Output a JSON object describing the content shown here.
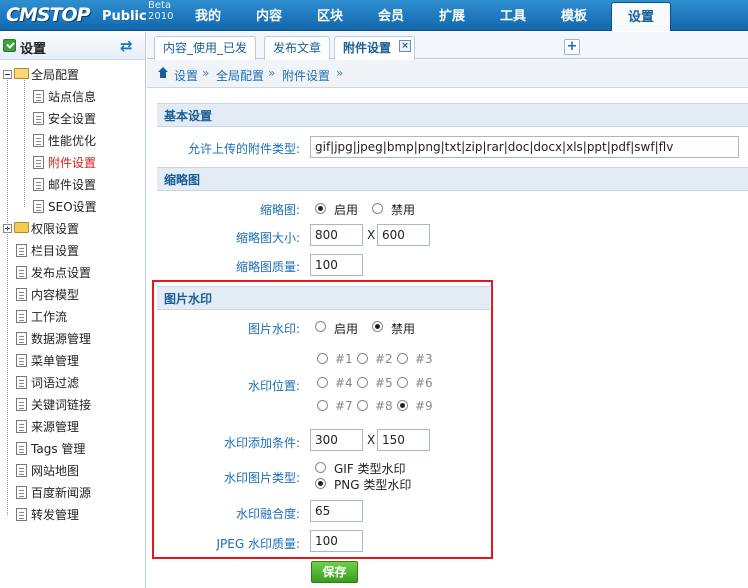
{
  "logo": {
    "brand": "CMSTOP",
    "edition": "Public",
    "beta": "Beta",
    "year": "2010"
  },
  "main_nav": [
    "我的",
    "内容",
    "区块",
    "会员",
    "扩展",
    "工具",
    "模板",
    "设置"
  ],
  "main_nav_active": "设置",
  "sidebar": {
    "title": "设置",
    "items": [
      {
        "label": "全局配置",
        "type": "folder-open"
      },
      {
        "label": "站点信息",
        "type": "child"
      },
      {
        "label": "安全设置",
        "type": "child"
      },
      {
        "label": "性能优化",
        "type": "child"
      },
      {
        "label": "附件设置",
        "type": "child",
        "selected": true
      },
      {
        "label": "邮件设置",
        "type": "child"
      },
      {
        "label": "SEO设置",
        "type": "child"
      },
      {
        "label": "权限设置",
        "type": "folder"
      },
      {
        "label": "栏目设置",
        "type": "doc"
      },
      {
        "label": "发布点设置",
        "type": "doc"
      },
      {
        "label": "内容模型",
        "type": "doc"
      },
      {
        "label": "工作流",
        "type": "doc"
      },
      {
        "label": "数据源管理",
        "type": "doc"
      },
      {
        "label": "菜单管理",
        "type": "doc"
      },
      {
        "label": "词语过滤",
        "type": "doc"
      },
      {
        "label": "关键词链接",
        "type": "doc"
      },
      {
        "label": "来源管理",
        "type": "doc"
      },
      {
        "label": "Tags 管理",
        "type": "doc"
      },
      {
        "label": "网站地图",
        "type": "doc"
      },
      {
        "label": "百度新闻源",
        "type": "doc"
      },
      {
        "label": "转发管理",
        "type": "doc"
      }
    ]
  },
  "tabs": [
    "内容_使用_已发",
    "发布文章",
    "附件设置"
  ],
  "active_tab": "附件设置",
  "tab_close": "×",
  "tab_add": "+",
  "breadcrumb": [
    "设置",
    "全局配置",
    "附件设置"
  ],
  "breadcrumb_sep": "»",
  "basic": {
    "section_title": "基本设置",
    "allowed_types_label": "允许上传的附件类型:",
    "allowed_types_value": "gif|jpg|jpeg|bmp|png|txt|zip|rar|doc|docx|xls|ppt|pdf|swf|flv"
  },
  "thumb": {
    "section_title": "缩略图",
    "thumb_label": "缩略图:",
    "enable": "启用",
    "disable": "禁用",
    "thumb_enabled": true,
    "size_label": "缩略图大小:",
    "width": "800",
    "height": "600",
    "x": "X",
    "quality_label": "缩略图质量:",
    "quality": "100"
  },
  "watermark": {
    "section_title": "图片水印",
    "wm_label": "图片水印:",
    "enable": "启用",
    "disable": "禁用",
    "wm_enabled": false,
    "position_label": "水印位置:",
    "positions": [
      "#1",
      "#2",
      "#3",
      "#4",
      "#5",
      "#6",
      "#7",
      "#8",
      "#9"
    ],
    "selected_position": "#9",
    "cond_label": "水印添加条件:",
    "cond_width": "300",
    "cond_height": "150",
    "x": "X",
    "type_label": "水印图片类型:",
    "type_gif": "GIF 类型水印",
    "type_png": "PNG 类型水印",
    "selected_type": "PNG",
    "blend_label": "水印融合度:",
    "blend": "65",
    "jpeg_label": "JPEG 水印质量:",
    "jpeg_quality": "100"
  },
  "save_label": "保存",
  "colors": {
    "accent": "#1b6fb5",
    "highlight_box": "#e01a1a",
    "save_button": "#4caf2a"
  }
}
